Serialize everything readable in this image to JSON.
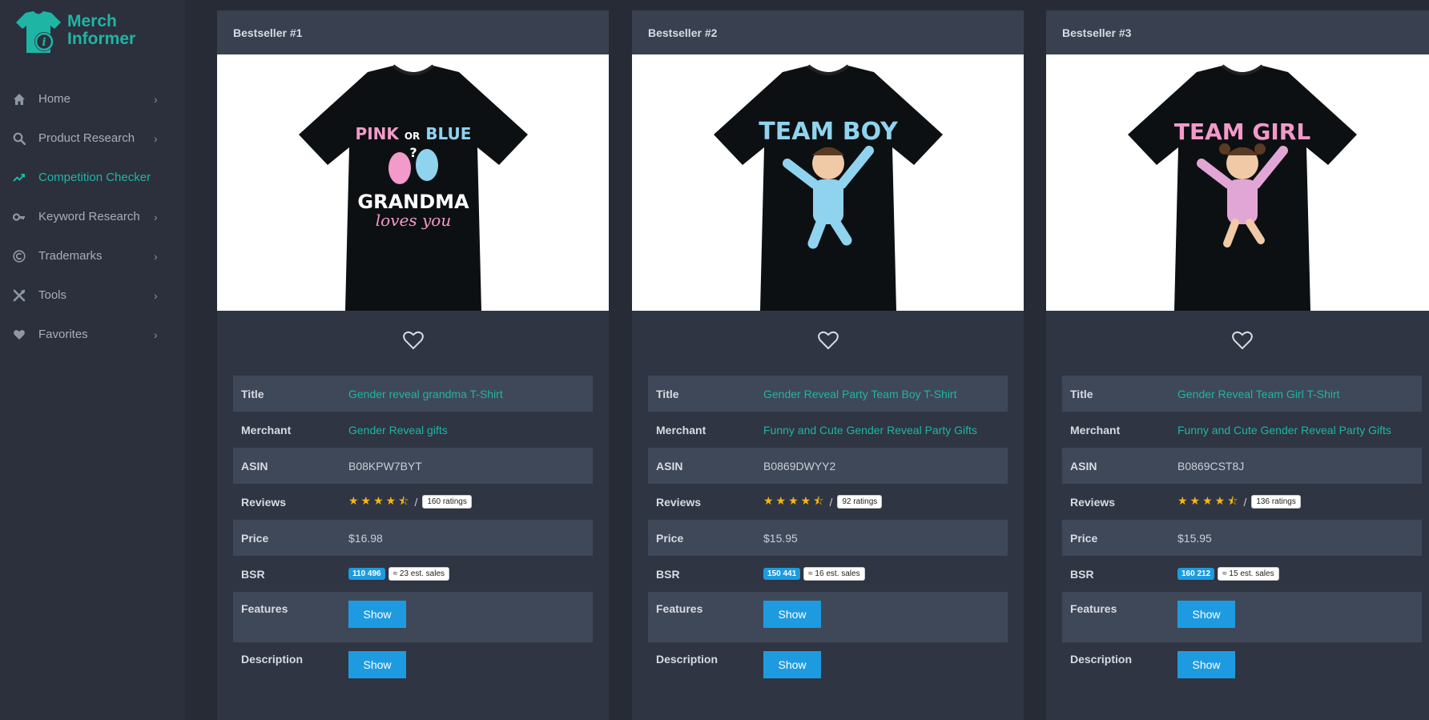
{
  "brand": {
    "line1": "Merch",
    "line2": "Informer",
    "color": "#1fb5a5"
  },
  "nav": [
    {
      "label": "Home",
      "icon": "home-icon",
      "active": false
    },
    {
      "label": "Product Research",
      "icon": "search-icon",
      "active": false
    },
    {
      "label": "Competition Checker",
      "icon": "trend-icon",
      "active": true
    },
    {
      "label": "Keyword Research",
      "icon": "key-icon",
      "active": false
    },
    {
      "label": "Trademarks",
      "icon": "copyright-icon",
      "active": false
    },
    {
      "label": "Tools",
      "icon": "tools-icon",
      "active": false
    },
    {
      "label": "Favorites",
      "icon": "heart-icon",
      "active": false
    }
  ],
  "labels": {
    "title": "Title",
    "merchant": "Merchant",
    "asin": "ASIN",
    "reviews": "Reviews",
    "price": "Price",
    "bsr": "BSR",
    "features": "Features",
    "description": "Description",
    "show": "Show",
    "slash": "/"
  },
  "cards": [
    {
      "header": "Bestseller #1",
      "shirt_design": "PINK OR BLUE GRANDMA loves you",
      "title": "Gender reveal grandma T-Shirt",
      "merchant": "Gender Reveal gifts",
      "asin": "B08KPW7BYT",
      "rating": 4.5,
      "ratings": "160 ratings",
      "price": "$16.98",
      "bsr": "110 496",
      "sales": "≈ 23 est. sales"
    },
    {
      "header": "Bestseller #2",
      "shirt_design": "TEAM BOY",
      "title": "Gender Reveal Party Team Boy T-Shirt",
      "merchant": "Funny and Cute Gender Reveal Party Gifts",
      "asin": "B0869DWYY2",
      "rating": 4.5,
      "ratings": "92 ratings",
      "price": "$15.95",
      "bsr": "150 441",
      "sales": "≈ 16 est. sales"
    },
    {
      "header": "Bestseller #3",
      "shirt_design": "TEAM GIRL",
      "title": "Gender Reveal Team Girl T-Shirt",
      "merchant": "Funny and Cute Gender Reveal Party Gifts",
      "asin": "B0869CST8J",
      "rating": 4.5,
      "ratings": "136 ratings",
      "price": "$15.95",
      "bsr": "160 212",
      "sales": "≈ 15 est. sales"
    }
  ]
}
